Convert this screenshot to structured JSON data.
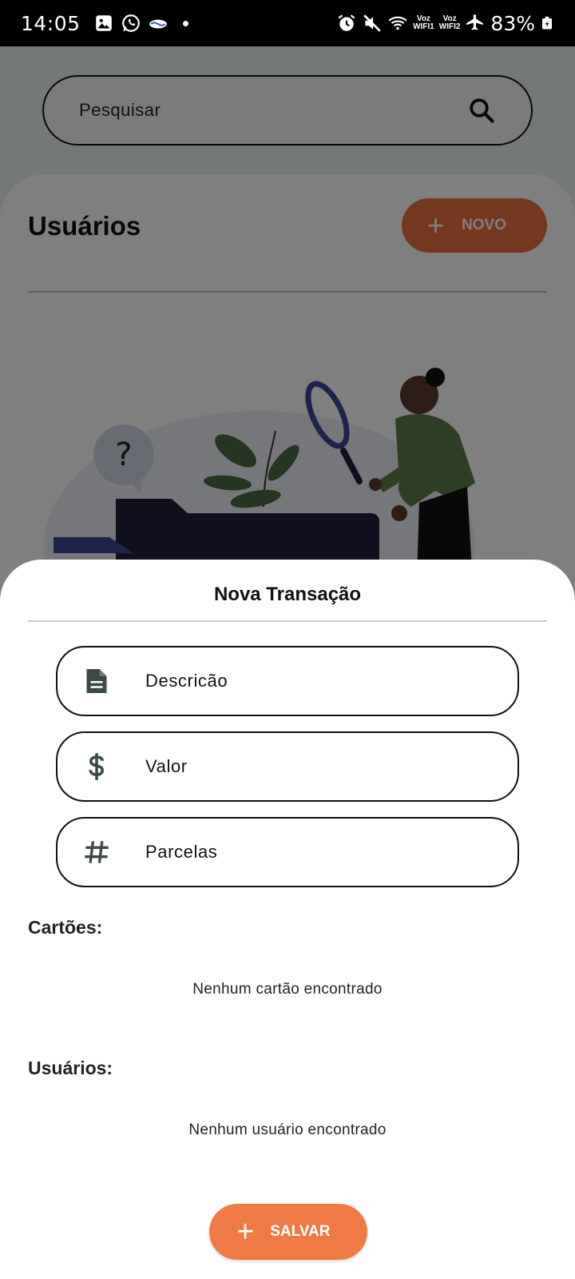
{
  "status_bar": {
    "time": "14:05",
    "battery": "83%",
    "voz1": "Voz",
    "wifi1": "WIFI1",
    "voz2": "Voz",
    "wifi2": "WIFI2",
    "left_icons": [
      "gallery-icon",
      "whatsapp-icon",
      "handshake-icon"
    ],
    "right_icons": [
      "alarm-icon",
      "mute-icon",
      "wifi-icon",
      "airplane-icon",
      "battery-icon"
    ]
  },
  "search": {
    "placeholder": "Pesquisar"
  },
  "panel": {
    "title": "Usuários",
    "new_button_label": "NOVO"
  },
  "sheet": {
    "title": "Nova Transação",
    "fields": [
      {
        "label": "Descricão",
        "icon": "document-icon"
      },
      {
        "label": "Valor",
        "icon": "dollar-icon"
      },
      {
        "label": "Parcelas",
        "icon": "hash-icon"
      }
    ],
    "cards_section": {
      "label": "Cartões:",
      "empty_message": "Nenhum cartão encontrado"
    },
    "users_section": {
      "label": "Usuários:",
      "empty_message": "Nenhum usuário encontrado"
    },
    "save_button_label": "SALVAR"
  },
  "colors": {
    "accent": "#f07a45",
    "text": "#111111",
    "sheet_bg": "#ffffff"
  }
}
